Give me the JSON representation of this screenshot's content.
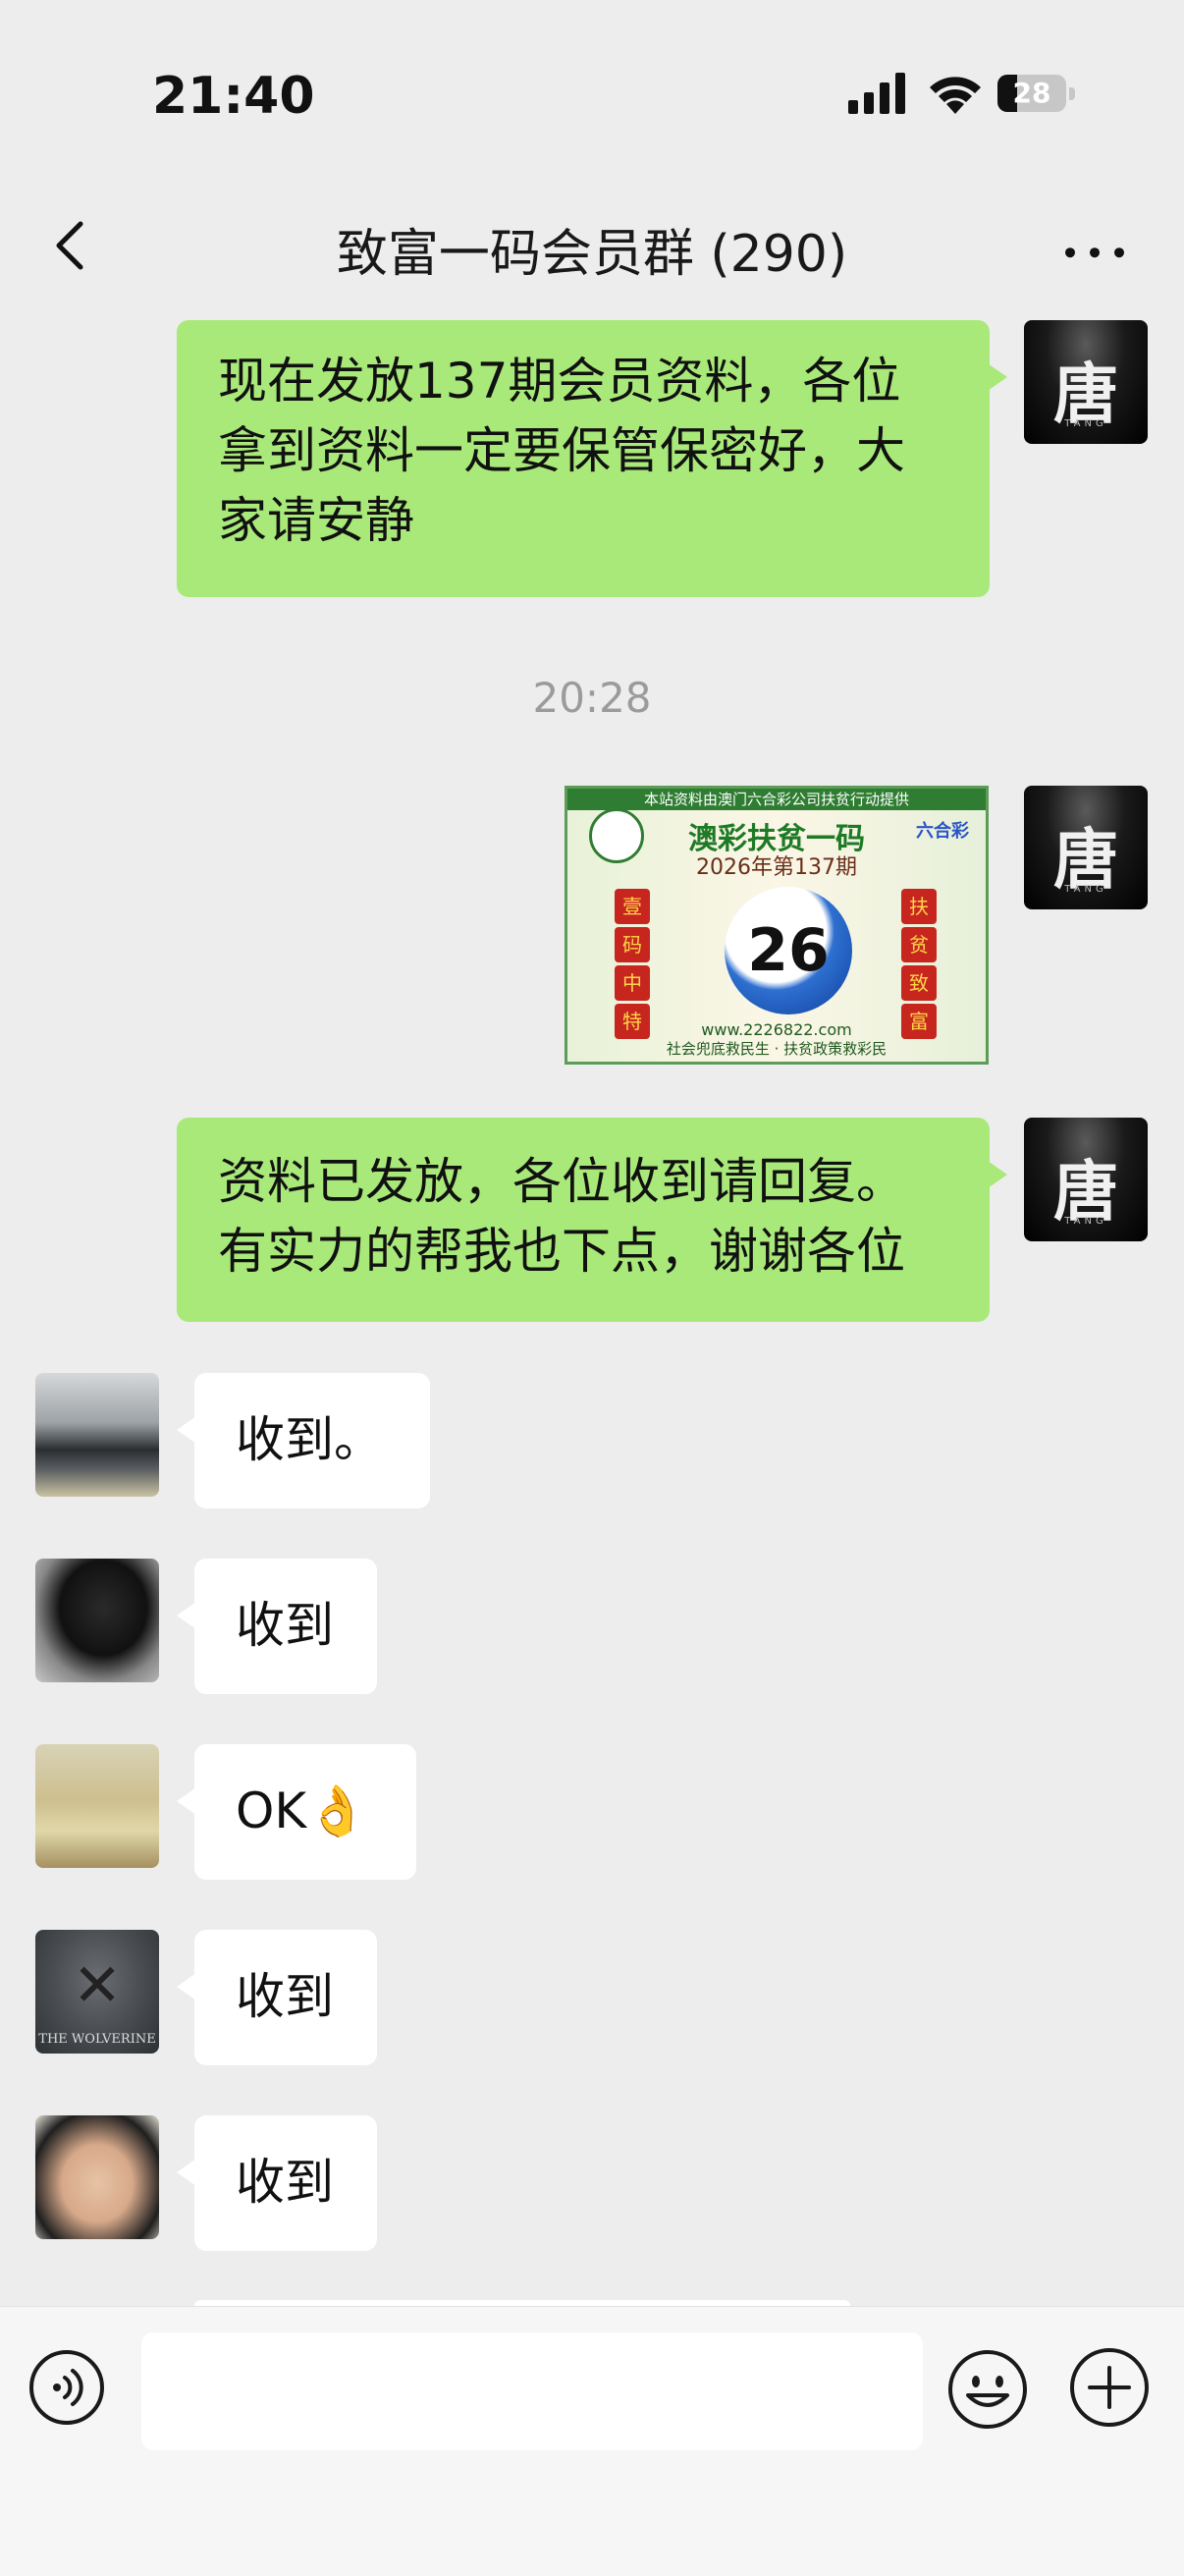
{
  "status_bar": {
    "time": "21:40",
    "battery": "28",
    "icons": [
      "cellular-signal-icon",
      "wifi-icon",
      "battery-icon"
    ]
  },
  "nav": {
    "title": "致富一码会员群 (290)",
    "back_icon": "chevron-left-icon",
    "more_icon": "more-dots-icon"
  },
  "messages": [
    {
      "type": "sent",
      "avatar_text": "唐",
      "avatar_sub": "TANG",
      "lines": [
        "现在发放137期会员资料，各位",
        "拿到资料一定要保管保密好，大",
        "家请安静"
      ]
    },
    {
      "type": "timestamp",
      "text": "20:28"
    },
    {
      "type": "sent_image",
      "avatar_text": "唐",
      "avatar_sub": "TANG",
      "image": {
        "banner": "本站资料由澳门六合彩公司扶贫行动提供",
        "headline": "澳彩扶贫一码",
        "issue": "2026年第137期",
        "number": "26",
        "left_chars": [
          "壹",
          "码",
          "中",
          "特"
        ],
        "right_chars": [
          "扶",
          "贫",
          "致",
          "富"
        ],
        "url": "www.2226822.com",
        "footer": "社会兜底救民生 · 扶贫政策救彩民",
        "logo": "六合彩"
      }
    },
    {
      "type": "sent",
      "avatar_text": "唐",
      "avatar_sub": "TANG",
      "lines": [
        "资料已发放，各位收到请回复。",
        "有实力的帮我也下点，谢谢各位"
      ]
    },
    {
      "type": "received",
      "text": "收到。"
    },
    {
      "type": "received",
      "text": "收到"
    },
    {
      "type": "received",
      "text": "OK👌"
    },
    {
      "type": "received",
      "text": "收到",
      "avatar_text": "THE WOLVERINE"
    },
    {
      "type": "received",
      "text": "收到"
    }
  ],
  "input_bar": {
    "voice_icon": "voice-input-icon",
    "emoji_icon": "emoji-icon",
    "plus_icon": "plus-circle-icon"
  },
  "colors": {
    "background": "#ededed",
    "sent_bubble": "#a9e97a",
    "received_bubble": "#ffffff"
  }
}
